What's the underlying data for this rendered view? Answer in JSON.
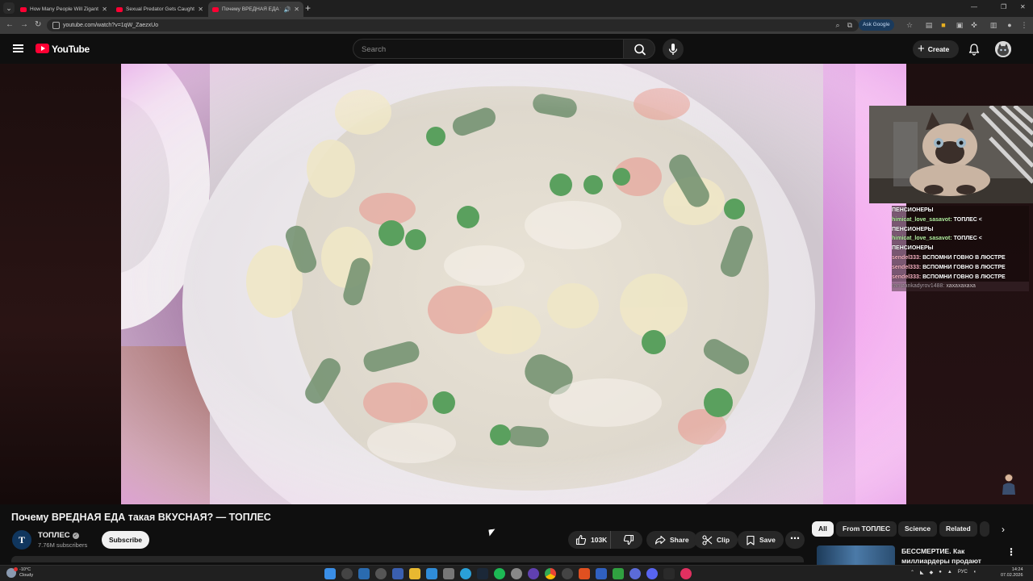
{
  "browser": {
    "tabs": [
      {
        "title": "How Many People Will Zigant N..."
      },
      {
        "title": "Sexual Predator Gets Caught in..."
      },
      {
        "title": "Почему ВРЕДНАЯ ЕДА та..."
      }
    ],
    "url": "youtube.com/watch?v=1qW_ZaezxUo",
    "ask_google_label": "Ask Google"
  },
  "header": {
    "logo_text": "YouTube",
    "search_placeholder": "Search",
    "create_label": "Create"
  },
  "stream_overlay": {
    "chat": [
      {
        "user": "",
        "message": "ПЕНСИОНЕРЫ",
        "style": "plain"
      },
      {
        "user": "himicat_love_sasavot:",
        "message": " ТОПЛЕС <",
        "style": "green"
      },
      {
        "user": "",
        "message": "ПЕНСИОНЕРЫ",
        "style": "plain"
      },
      {
        "user": "himicat_love_sasavot:",
        "message": " ТОПЛЕС <",
        "style": "green"
      },
      {
        "user": "",
        "message": "ПЕНСИОНЕРЫ",
        "style": "plain"
      },
      {
        "user": "sendel333:",
        "message": " ВСПОМНИ ГОВНО В ЛЮСТРЕ",
        "style": "pink"
      },
      {
        "user": "sendel333:",
        "message": " ВСПОМНИ ГОВНО В ЛЮСТРЕ",
        "style": "pink"
      },
      {
        "user": "sendel333:",
        "message": " ВСПОМНИ ГОВНО В ЛЮСТРЕ",
        "style": "pink"
      },
      {
        "user": "ramzankadyrov1488:",
        "message": " хахахахаха",
        "style": "dim"
      }
    ]
  },
  "video": {
    "title": "Почему ВРЕДНАЯ ЕДА такая ВКУСНАЯ? — ТОПЛЕС",
    "channel_name": "ТОПЛЕС",
    "channel_initial": "T",
    "subscribers": "7.76M subscribers",
    "subscribe_label": "Subscribe",
    "likes": "103K",
    "share_label": "Share",
    "clip_label": "Clip",
    "save_label": "Save"
  },
  "sidebar": {
    "chips": [
      {
        "label": "All",
        "active": true
      },
      {
        "label": "From ТОПЛЕС",
        "active": false
      },
      {
        "label": "Science",
        "active": false
      },
      {
        "label": "Related",
        "active": false
      }
    ],
    "recommendation_title": "БЕССМЕРТИЕ. Как миллиардеры продают"
  },
  "taskbar": {
    "temperature": "-10°C",
    "condition": "Cloudy",
    "language": "РУС",
    "time": "14:24",
    "date": "07.02.2026"
  },
  "colors": {
    "brand_red": "#ff0033",
    "page_bg": "#0f0f0f",
    "pill_bg": "#272727"
  }
}
